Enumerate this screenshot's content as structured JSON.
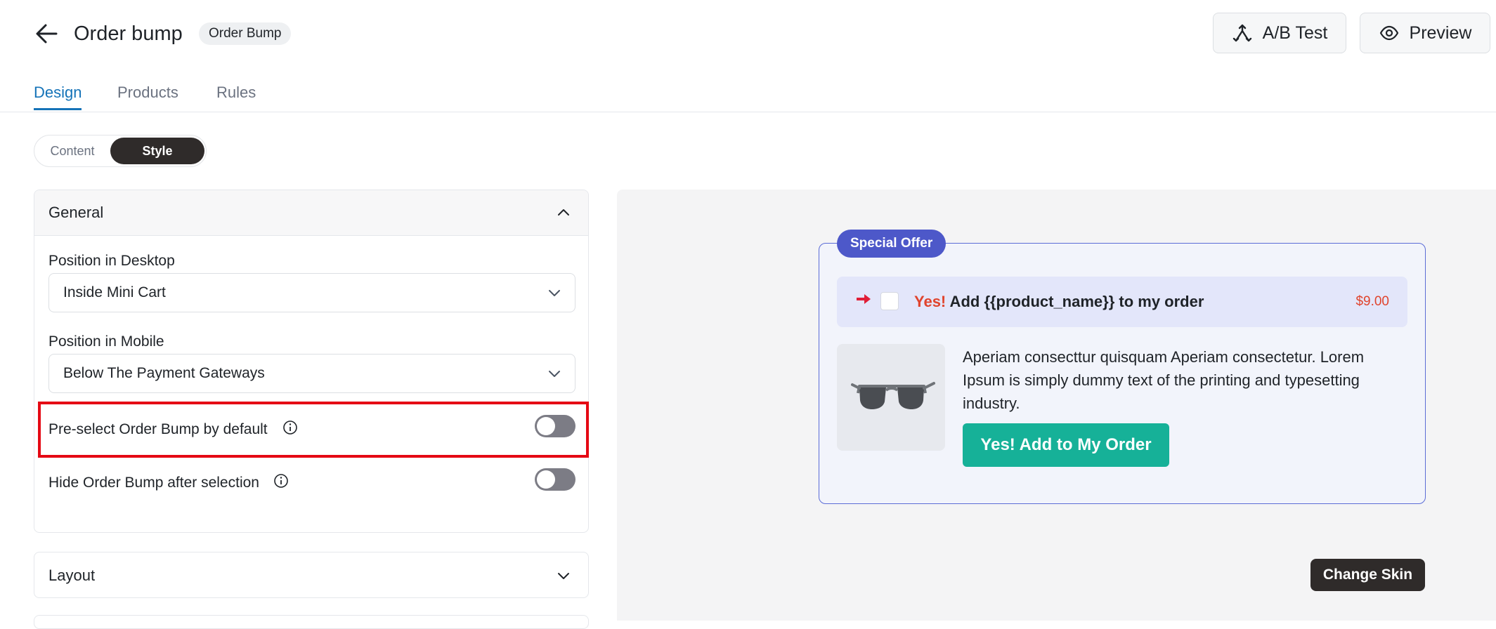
{
  "header": {
    "title": "Order bump",
    "type_badge": "Order Bump",
    "ab_test_label": "A/B Test",
    "preview_label": "Preview"
  },
  "tabs": [
    {
      "label": "Design",
      "active": true
    },
    {
      "label": "Products",
      "active": false
    },
    {
      "label": "Rules",
      "active": false
    }
  ],
  "segmented": {
    "content_label": "Content",
    "style_label": "Style",
    "selected": "Style"
  },
  "general": {
    "title": "General",
    "expanded": true,
    "desktop_label": "Position in Desktop",
    "desktop_value": "Inside Mini Cart",
    "mobile_label": "Position in Mobile",
    "mobile_value": "Below The Payment Gateways",
    "preselect_label": "Pre-select Order Bump by default",
    "preselect_on": false,
    "hide_label": "Hide Order Bump after selection",
    "hide_on": false
  },
  "layout": {
    "title": "Layout",
    "expanded": false
  },
  "preview": {
    "badge": "Special Offer",
    "headline_yes": "Yes!",
    "headline_rest": " Add {{product_name}} to my order",
    "price": "$9.00",
    "description": "Aperiam consecttur quisquam Aperiam consectetur. Lorem Ipsum is simply dummy text of the printing and typesetting industry.",
    "cta_label": "Yes! Add to My Order",
    "change_skin_label": "Change Skin",
    "product_image": "sunglasses-image"
  },
  "colors": {
    "accent": "#1573b8",
    "offer_badge": "#4d58c9",
    "bump_border": "#5b6cd6",
    "cta": "#16b198",
    "price": "#e0442d",
    "highlight": "#e50914"
  }
}
